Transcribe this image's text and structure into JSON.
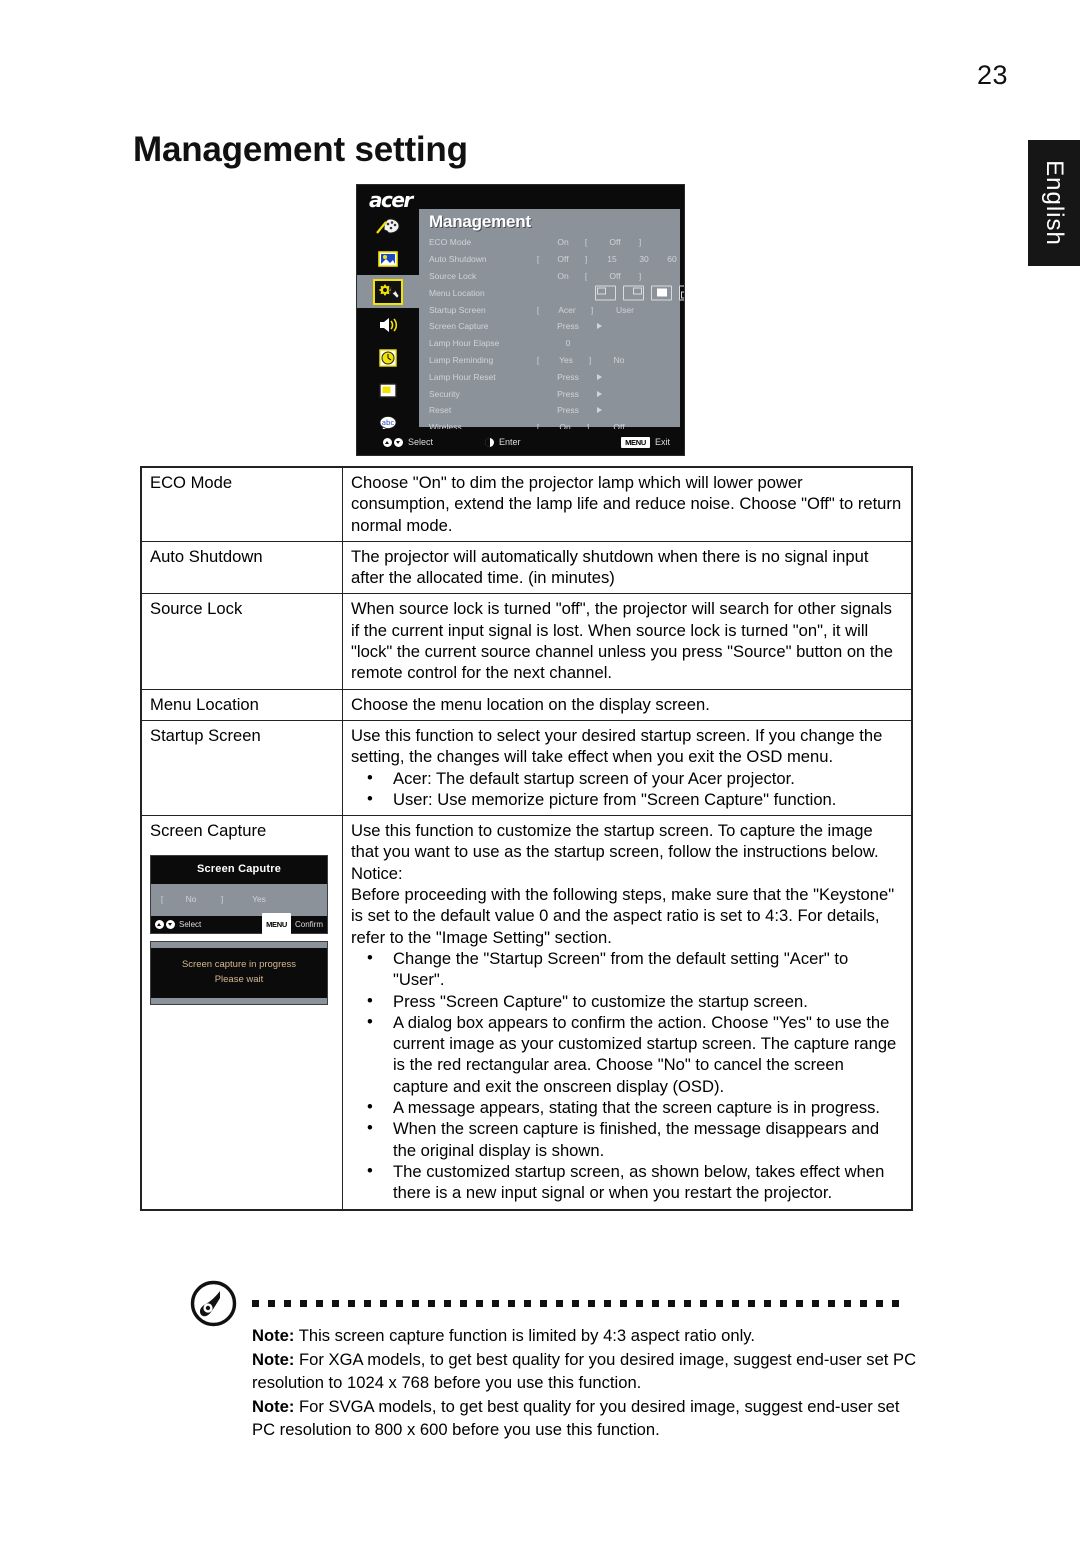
{
  "page": {
    "number": "23",
    "title": "Management setting",
    "language_tab": "English"
  },
  "osd": {
    "brand": "acer",
    "panel_title": "Management",
    "sidebar_icons": [
      {
        "name": "color-palette-icon",
        "selected": false
      },
      {
        "name": "image-picture-icon",
        "selected": false
      },
      {
        "name": "management-gear-wrench-icon",
        "selected": true
      },
      {
        "name": "audio-speaker-icon",
        "selected": false
      },
      {
        "name": "timer-clock-icon",
        "selected": false
      },
      {
        "name": "display-screen-icon",
        "selected": false
      },
      {
        "name": "language-abc-bubble-icon",
        "selected": false
      }
    ],
    "rows": [
      {
        "label": "ECO Mode",
        "type": "options",
        "values": [
          "On",
          "[",
          "Off",
          "]"
        ]
      },
      {
        "label": "Auto Shutdown",
        "type": "options",
        "values": [
          "[",
          "Off",
          "]",
          "15",
          "30",
          "60"
        ]
      },
      {
        "label": "Source Lock",
        "type": "options",
        "values": [
          "On",
          "[",
          "Off",
          "]"
        ]
      },
      {
        "label": "Menu Location",
        "type": "location",
        "values": []
      },
      {
        "label": "Startup Screen",
        "type": "options",
        "values": [
          "[",
          "Acer",
          "]",
          "User"
        ]
      },
      {
        "label": "Screen Capture",
        "type": "press",
        "values": [
          "Press"
        ]
      },
      {
        "label": "Lamp Hour Elapse",
        "type": "value",
        "values": [
          "0"
        ]
      },
      {
        "label": "Lamp Reminding",
        "type": "options",
        "values": [
          "[",
          "Yes",
          "]",
          "No"
        ]
      },
      {
        "label": "Lamp Hour Reset",
        "type": "press",
        "values": [
          "Press"
        ]
      },
      {
        "label": "Security",
        "type": "press",
        "values": [
          "Press"
        ]
      },
      {
        "label": "Reset",
        "type": "press",
        "values": [
          "Press"
        ]
      },
      {
        "label": "Wireless",
        "type": "options",
        "values": [
          "[",
          "On",
          "]",
          "Off"
        ]
      }
    ],
    "footer": {
      "select": "Select",
      "enter": "Enter",
      "menu_key": "MENU",
      "exit": "Exit"
    }
  },
  "table": {
    "rows": [
      {
        "feature": "ECO Mode",
        "paragraphs": [
          "Choose \"On\" to dim the projector lamp which will lower power consumption, extend the lamp life and reduce noise.  Choose \"Off\" to return normal mode."
        ],
        "bullets": []
      },
      {
        "feature": "Auto Shutdown",
        "paragraphs": [
          "The projector will automatically shutdown when there is no signal input after the allocated time. (in minutes)"
        ],
        "bullets": []
      },
      {
        "feature": "Source Lock",
        "paragraphs": [
          "When source lock is turned \"off\", the projector will search for other signals if the current input signal is lost. When source lock is turned \"on\", it will \"lock\" the current source channel unless you press \"Source\" button on the remote control for the next channel."
        ],
        "bullets": []
      },
      {
        "feature": "Menu Location",
        "paragraphs": [
          "Choose the menu location on the display screen."
        ],
        "bullets": []
      },
      {
        "feature": "Startup Screen",
        "paragraphs": [
          "Use this function to select your desired startup screen. If you change the setting, the changes will take effect when you exit the OSD menu."
        ],
        "bullets": [
          "Acer: The default startup screen of your Acer projector.",
          "User: Use memorize picture from \"Screen Capture\" function."
        ]
      },
      {
        "feature": "Screen Capture",
        "paragraphs": [
          "Use this function to customize the startup screen. To capture the image that you want to use as the startup screen, follow the instructions below.",
          "Notice:",
          "Before proceeding with the following steps, make sure that the \"Keystone\" is set to the default value 0 and the aspect ratio is set to 4:3. For details, refer to the \"Image Setting\" section."
        ],
        "bullets": [
          "Change the \"Startup Screen\" from the default setting \"Acer\" to \"User\".",
          "Press \"Screen Capture\" to customize the startup screen.",
          "A dialog box appears to confirm the action. Choose \"Yes\" to use the current image as your customized startup screen. The capture range is the red rectangular area. Choose \"No\" to cancel the screen capture and exit the onscreen display (OSD).",
          "A message appears, stating that the screen capture is in progress.",
          "When the screen capture is finished, the message disappears and the original display is shown.",
          "The customized startup screen, as shown below, takes effect when there is a new input signal or when you restart the projector."
        ]
      }
    ]
  },
  "capture_dialog": {
    "title": "Screen Caputre",
    "options": [
      "[",
      "No",
      "]",
      "Yes"
    ],
    "footer": {
      "select": "Select",
      "menu_key": "MENU",
      "confirm": "Confirm"
    }
  },
  "capture_progress": {
    "line1": "Screen capture in progress",
    "line2": "Please wait"
  },
  "notes": {
    "icon": "note-hand-icon",
    "items": [
      {
        "label": "Note:",
        "text": " This screen capture function is limited by 4:3 aspect ratio only."
      },
      {
        "label": "Note:",
        "text": " For XGA models, to get best quality for you desired image, suggest end-user set PC resolution to 1024 x 768 before you use this function."
      },
      {
        "label": "Note:",
        "text": " For SVGA models, to get best quality for you desired image, suggest end-user set PC resolution to 800 x 600 before you use this function."
      }
    ]
  },
  "colors": {
    "osd_panel": "#8c9299",
    "osd_black": "#0b0b0b",
    "accent_yellow": "#f2e400",
    "progress_text": "#d6b98f"
  }
}
